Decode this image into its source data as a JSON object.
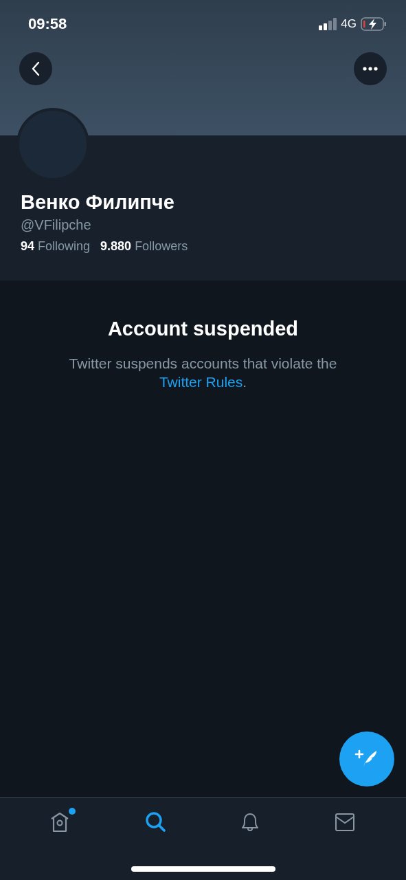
{
  "status_bar": {
    "time": "09:58",
    "network": "4G"
  },
  "profile": {
    "name": "Венко Филипче",
    "handle": "@VFilipche",
    "stats": [
      {
        "text": "**94** Following"
      },
      {
        "text": "**9.880** Followers"
      }
    ]
  },
  "notice": {
    "title": "Account suspended",
    "text": "Twitter suspends accounts that violate the",
    "link": "Twitter Rules",
    "after": "."
  },
  "tabs": [
    {
      "kind": "home",
      "selected": false,
      "badge": true
    },
    {
      "kind": "search",
      "selected": true,
      "badge": false
    },
    {
      "kind": "notifications",
      "selected": false,
      "badge": false
    },
    {
      "kind": "messages",
      "selected": false,
      "badge": false
    }
  ]
}
